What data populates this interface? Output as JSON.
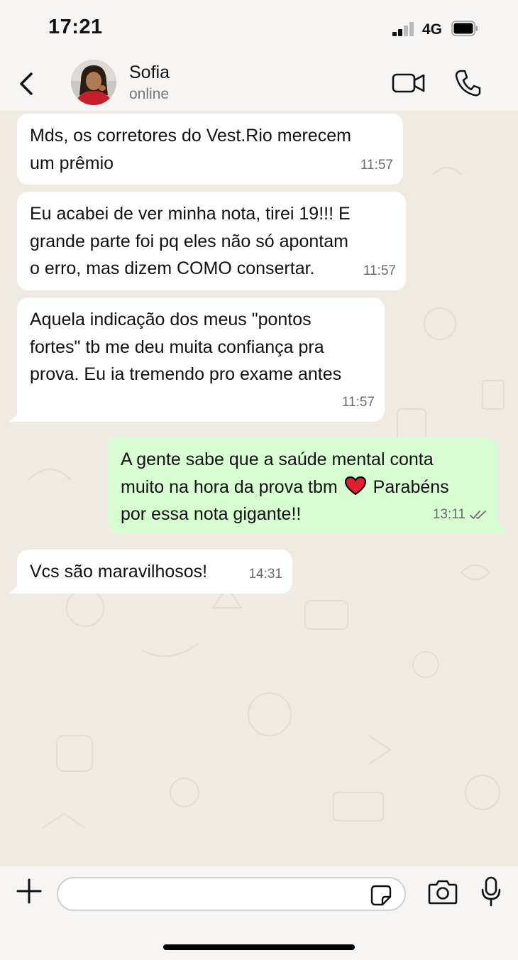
{
  "status_bar": {
    "time": "17:21",
    "network": "4G"
  },
  "header": {
    "contact_name": "Sofia",
    "contact_status": "online"
  },
  "messages": [
    {
      "direction": "in",
      "lines": [
        "Mds, os corretores do Vest.Rio merecem",
        "um prêmio"
      ],
      "time": "11:57"
    },
    {
      "direction": "in",
      "lines": [
        "Eu acabei de ver minha nota, tirei 19!!! E",
        "grande parte foi pq eles não só apontam",
        "o erro, mas dizem COMO consertar."
      ],
      "time": "11:57"
    },
    {
      "direction": "in",
      "lines": [
        "Aquela indicação dos meus \"pontos",
        "fortes\" tb me deu muita confiança pra",
        "prova. Eu ia tremendo pro exame antes"
      ],
      "time": "11:57"
    },
    {
      "direction": "out",
      "line1": "A gente sabe que a saúde mental conta",
      "line2_a": "muito na hora da prova tbm",
      "line2_b": "Parabéns",
      "line3": "por essa nota gigante!!",
      "time": "13:11",
      "read": true
    },
    {
      "direction": "in",
      "lines": [
        "Vcs são maravilhosos!"
      ],
      "time": "14:31"
    }
  ],
  "composer": {
    "value": "",
    "placeholder": ""
  },
  "colors": {
    "incoming_bubble": "#ffffff",
    "outgoing_bubble": "#d9fdd3",
    "chat_background": "#efeae2",
    "bar_background": "#f6f5f3",
    "read_ticks": "#6b6b6b"
  },
  "icons": {
    "back": "chevron-left-icon",
    "video_call": "video-camera-icon",
    "voice_call": "phone-icon",
    "attach": "plus-icon",
    "sticker": "sticker-icon",
    "camera": "camera-icon",
    "microphone": "microphone-icon",
    "emoji_in_message": "red-heart-icon"
  }
}
